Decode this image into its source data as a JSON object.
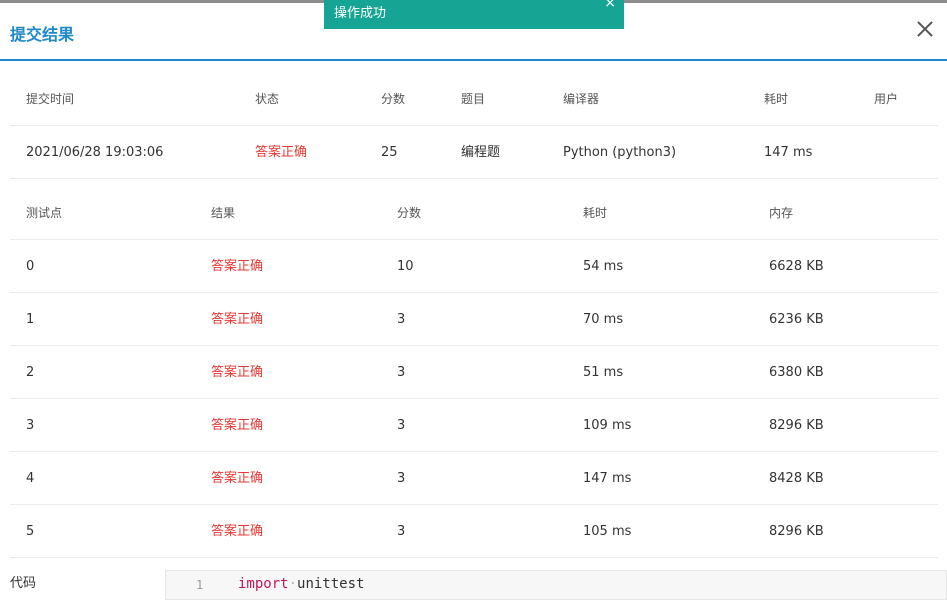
{
  "dialog": {
    "title": "提交结果"
  },
  "toast": {
    "message": "操作成功",
    "close_glyph": "×"
  },
  "summary": {
    "headers": [
      "提交时间",
      "状态",
      "分数",
      "题目",
      "编译器",
      "耗时",
      "用户"
    ],
    "row": [
      "2021/06/28 19:03:06",
      "答案正确",
      "25",
      "编程题",
      "Python (python3)",
      "147 ms",
      ""
    ]
  },
  "testpoints": {
    "headers": [
      "测试点",
      "结果",
      "分数",
      "耗时",
      "内存"
    ],
    "rows": [
      [
        "0",
        "答案正确",
        "10",
        "54 ms",
        "6628 KB"
      ],
      [
        "1",
        "答案正确",
        "3",
        "70 ms",
        "6236 KB"
      ],
      [
        "2",
        "答案正确",
        "3",
        "51 ms",
        "6380 KB"
      ],
      [
        "3",
        "答案正确",
        "3",
        "109 ms",
        "8296 KB"
      ],
      [
        "4",
        "答案正确",
        "3",
        "147 ms",
        "8428 KB"
      ],
      [
        "5",
        "答案正确",
        "3",
        "105 ms",
        "8296 KB"
      ]
    ]
  },
  "code": {
    "label": "代码",
    "line_number": "1",
    "keyword": "import",
    "module": "unittest"
  },
  "colors": {
    "accent": "#1e88c9",
    "toast_bg": "#16a595",
    "status_ok": "#e53935"
  }
}
